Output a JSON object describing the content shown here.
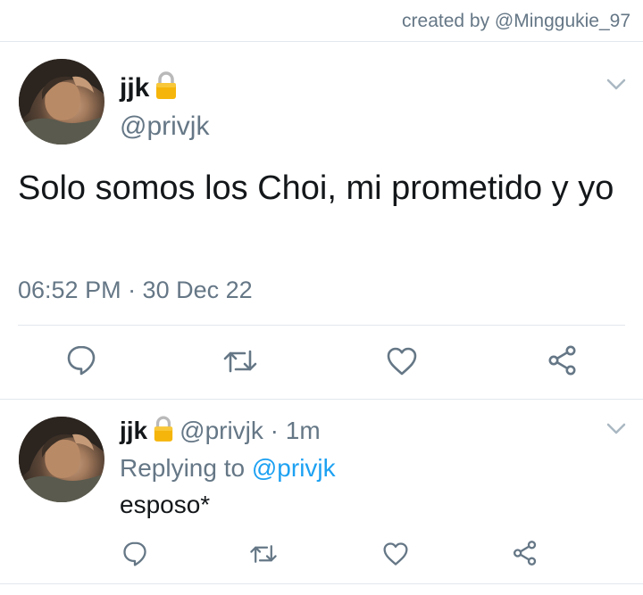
{
  "credit": "created by @Minggukie_97",
  "tweet": {
    "name": "jjk",
    "handle": "@privjk",
    "text": "Solo somos los Choi, mi prometido y yo",
    "timestamp": "06:52 PM · 30 Dec 22"
  },
  "reply": {
    "name": "jjk",
    "handle": "@privjk",
    "separator": " · ",
    "time": "1m",
    "replying_prefix": "Replying to ",
    "replying_to": "@privjk",
    "text": "esposo*"
  },
  "icons": {
    "lock": "lock-icon",
    "chevron": "chevron-down-icon",
    "reply": "reply-icon",
    "retweet": "retweet-icon",
    "like": "heart-icon",
    "share": "share-icon"
  },
  "colors": {
    "text": "#14171a",
    "secondary": "#657786",
    "link": "#1da1f2",
    "divider": "#e1e8ed",
    "lock_body": "#f5b50a"
  }
}
